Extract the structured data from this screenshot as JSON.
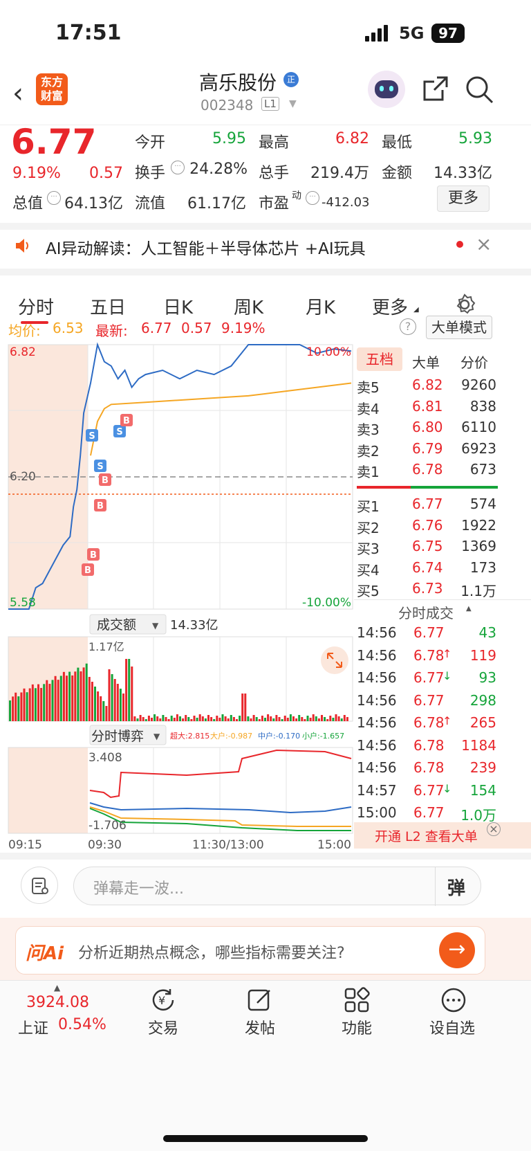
{
  "status": {
    "time": "17:51",
    "network": "5G",
    "battery": "97"
  },
  "nav": {
    "logo_line1": "东方",
    "logo_line2": "财富",
    "title": "高乐股份",
    "title_badge": "正",
    "code": "002348",
    "level": "L1"
  },
  "quote": {
    "price": "6.77",
    "pct": "9.19%",
    "change": "0.57",
    "open_label": "今开",
    "open": "5.95",
    "high_label": "最高",
    "high": "6.82",
    "low_label": "最低",
    "low": "5.93",
    "turnover_label": "换手",
    "turnover": "24.28%",
    "volume_label": "总手",
    "volume": "219.4万",
    "amount_label": "金额",
    "amount": "14.33亿",
    "mcap_label": "总值",
    "mcap": "64.13亿",
    "float_label": "流值",
    "float_cap": "61.17亿",
    "pe_label": "市盈",
    "pe_sup": "动",
    "pe": "-412.03",
    "more_button": "更多"
  },
  "ai_banner": {
    "text": "AI异动解读：人工智能＋半导体芯片 +AI玩具"
  },
  "tabs": [
    "分时",
    "五日",
    "日K",
    "周K",
    "月K",
    "更多"
  ],
  "chart_header": {
    "avg_label": "均价:",
    "avg": "6.53",
    "latest_label": "最新:",
    "latest": "6.77",
    "change": "0.57",
    "pct": "9.19%",
    "big_order_button": "大单模式"
  },
  "chart_data": {
    "type": "line",
    "y_max_label": "6.82",
    "y_min_label": "5.58",
    "prev_close_label": "6.20",
    "pct_max_label": "10.00%",
    "pct_min_label": "-10.00%",
    "x_labels": [
      "09:15",
      "09:30",
      "11:30/13:00",
      "15:00"
    ],
    "series": [
      {
        "name": "价格",
        "color": "#2d6bc4",
        "x": [
          0,
          2,
          4,
          6,
          8,
          10,
          12,
          14,
          16,
          18,
          19,
          20,
          21,
          22,
          24,
          26,
          28,
          30,
          32,
          34,
          36,
          38,
          40,
          45,
          50,
          55,
          60,
          65,
          70,
          75,
          80,
          85,
          90,
          95,
          100
        ],
        "y": [
          5.58,
          5.58,
          5.58,
          5.58,
          5.68,
          5.7,
          5.76,
          5.82,
          5.88,
          5.92,
          6.06,
          6.14,
          6.3,
          6.5,
          6.64,
          6.82,
          6.74,
          6.72,
          6.66,
          6.7,
          6.62,
          6.66,
          6.68,
          6.7,
          6.66,
          6.7,
          6.68,
          6.72,
          6.82,
          6.82,
          6.82,
          6.82,
          6.78,
          6.8,
          6.79
        ]
      },
      {
        "name": "均价",
        "color": "#f5a623",
        "x": [
          24,
          26,
          28,
          30,
          40,
          50,
          60,
          70,
          80,
          90,
          100
        ],
        "y": [
          6.3,
          6.46,
          6.52,
          6.54,
          6.55,
          6.56,
          6.57,
          6.58,
          6.6,
          6.62,
          6.64
        ]
      }
    ]
  },
  "volume_panel": {
    "selector": "成交额",
    "value": "14.33亿",
    "axis_label": "1.17亿"
  },
  "game_panel": {
    "selector": "分时博弈",
    "super_large": "超大:2.815",
    "large": "大户:-0.987",
    "medium": "中户:-0.170",
    "small": "小户:-1.657",
    "top_label": "3.408",
    "bottom_label": "-1.706"
  },
  "orderbook": {
    "tabs": [
      "五档",
      "大单",
      "分价"
    ],
    "sells": [
      {
        "label": "卖5",
        "price": "6.82",
        "vol": "9260"
      },
      {
        "label": "卖4",
        "price": "6.81",
        "vol": "838"
      },
      {
        "label": "卖3",
        "price": "6.80",
        "vol": "6110"
      },
      {
        "label": "卖2",
        "price": "6.79",
        "vol": "6923"
      },
      {
        "label": "卖1",
        "price": "6.78",
        "vol": "673"
      }
    ],
    "buys": [
      {
        "label": "买1",
        "price": "6.77",
        "vol": "574"
      },
      {
        "label": "买2",
        "price": "6.76",
        "vol": "1922"
      },
      {
        "label": "买3",
        "price": "6.75",
        "vol": "1369"
      },
      {
        "label": "买4",
        "price": "6.74",
        "vol": "173"
      },
      {
        "label": "买5",
        "price": "6.73",
        "vol": "1.1万"
      }
    ],
    "ticks_title": "分时成交",
    "ticks": [
      {
        "time": "14:56",
        "price": "6.77",
        "arrow": "",
        "vol": "43",
        "vc": "green"
      },
      {
        "time": "14:56",
        "price": "6.78",
        "arrow": "↑",
        "vol": "119",
        "vc": "red"
      },
      {
        "time": "14:56",
        "price": "6.77",
        "arrow": "↓",
        "vol": "93",
        "vc": "green"
      },
      {
        "time": "14:56",
        "price": "6.77",
        "arrow": "",
        "vol": "298",
        "vc": "green"
      },
      {
        "time": "14:56",
        "price": "6.78",
        "arrow": "↑",
        "vol": "265",
        "vc": "red"
      },
      {
        "time": "14:56",
        "price": "6.78",
        "arrow": "",
        "vol": "1184",
        "vc": "red"
      },
      {
        "time": "14:56",
        "price": "6.78",
        "arrow": "",
        "vol": "239",
        "vc": "red"
      },
      {
        "time": "14:57",
        "price": "6.77",
        "arrow": "↓",
        "vol": "154",
        "vc": "green"
      },
      {
        "time": "15:00",
        "price": "6.77",
        "arrow": "",
        "vol": "1.0万",
        "vc": "green"
      }
    ],
    "l2_promo": "开通 L2 查看大单"
  },
  "danmaku": {
    "placeholder": "弹幕走一波...",
    "button": "弹"
  },
  "ask_ai": {
    "brand": "问Ai",
    "prompt": "分析近期热点概念，哪些指标需要关注?"
  },
  "bottom_nav": {
    "index_value": "3924.08",
    "index_name": "上证",
    "index_pct": "0.54%",
    "items": [
      "交易",
      "发帖",
      "功能",
      "设自选"
    ]
  }
}
